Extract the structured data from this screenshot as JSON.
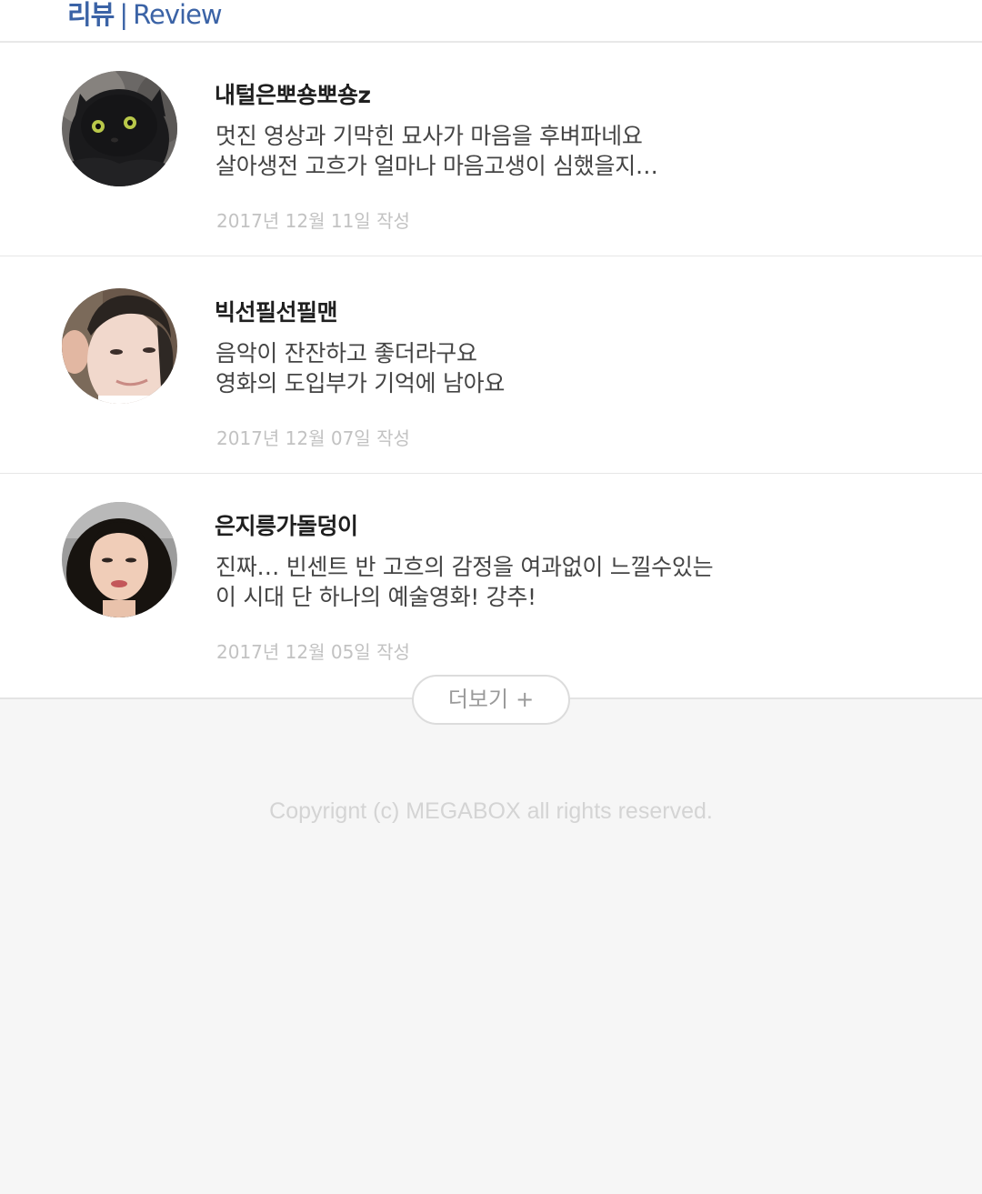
{
  "header": {
    "title_ko": "리뷰",
    "separator": "|",
    "title_en": "Review"
  },
  "reviews": [
    {
      "nickname": "내털은뽀숑뽀숑z",
      "lines": [
        "멋진 영상과 기막힌 묘사가 마음을 후벼파네요",
        "살아생전 고흐가 얼마나 마음고생이 심했을지…"
      ],
      "date": "2017년 12월 11일 작성",
      "avatar_icon": "black-cat-avatar"
    },
    {
      "nickname": "빅선필선필맨",
      "lines": [
        "음악이 잔잔하고 좋더라구요",
        "영화의 도입부가 기억에 남아요"
      ],
      "date": "2017년 12월 07일 작성",
      "avatar_icon": "man-selfie-avatar"
    },
    {
      "nickname": "은지릉가돌덩이",
      "lines": [
        "진짜… 빈센트 반 고흐의 감정을 여과없이 느낄수있는",
        "이 시대 단 하나의 예술영화! 강추!"
      ],
      "date": "2017년 12월 05일 작성",
      "avatar_icon": "woman-selfie-avatar"
    }
  ],
  "more_button": {
    "label": "더보기",
    "icon": "+"
  },
  "footer": {
    "copyright": "Copyrignt (c) MEGABOX all rights reserved."
  },
  "colors": {
    "accent": "#3b63a6",
    "background": "#f6f6f6",
    "date_text": "#c2c2c2"
  }
}
